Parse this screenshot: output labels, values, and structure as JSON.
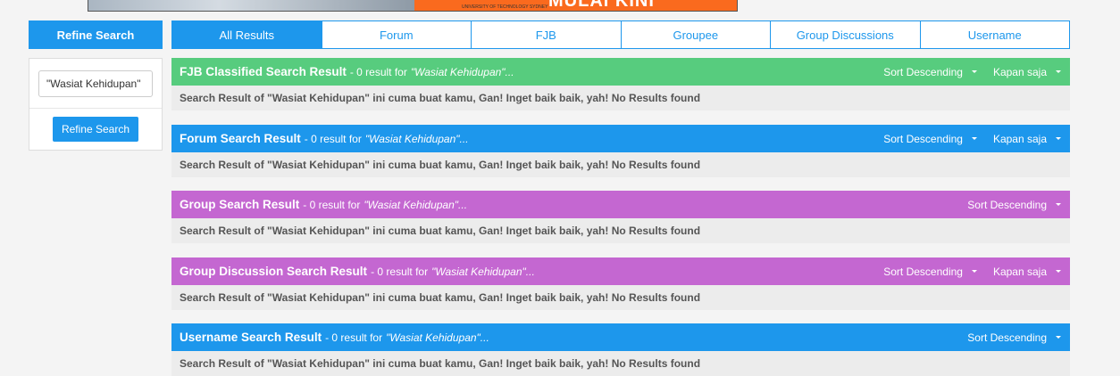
{
  "banner": {
    "university": "UNIVERSITY OF TECHNOLOGY SYDNEY",
    "cta": "MULAI KINI"
  },
  "sidebar": {
    "header": "Refine Search",
    "input_value": "\"Wasiat Kehidupan\"",
    "button_label": "Refine Search"
  },
  "tabs": [
    {
      "label": "All Results"
    },
    {
      "label": "Forum"
    },
    {
      "label": "FJB"
    },
    {
      "label": "Groupee"
    },
    {
      "label": "Group Discussions"
    },
    {
      "label": "Username"
    }
  ],
  "results": [
    {
      "title": "FJB Classified Search Result",
      "count": "- 0 result for",
      "query": "\"Wasiat Kehidupan\"...",
      "sort": "Sort Descending",
      "time": "Kapan saja",
      "message": "Search Result of \"Wasiat Kehidupan\" ini cuma buat kamu, Gan! Inget baik baik, yah! No Results found",
      "color": "#57cc7e"
    },
    {
      "title": "Forum Search Result",
      "count": "- 0 result for",
      "query": "\"Wasiat Kehidupan\"...",
      "sort": "Sort Descending",
      "time": "Kapan saja",
      "message": "Search Result of \"Wasiat Kehidupan\" ini cuma buat kamu, Gan! Inget baik baik, yah! No Results found",
      "color": "#1d97ec"
    },
    {
      "title": "Group Search Result",
      "count": "- 0 result for",
      "query": "\"Wasiat Kehidupan\"...",
      "sort": "Sort Descending",
      "message": "Search Result of \"Wasiat Kehidupan\" ini cuma buat kamu, Gan! Inget baik baik, yah! No Results found",
      "color": "#c467d1"
    },
    {
      "title": "Group Discussion Search Result",
      "count": "- 0 result for",
      "query": "\"Wasiat Kehidupan\"...",
      "sort": "Sort Descending",
      "time": "Kapan saja",
      "message": "Search Result of \"Wasiat Kehidupan\" ini cuma buat kamu, Gan! Inget baik baik, yah! No Results found",
      "color": "#c467d1"
    },
    {
      "title": "Username Search Result",
      "count": "- 0 result for",
      "query": "\"Wasiat Kehidupan\"...",
      "sort": "Sort Descending",
      "message": "Search Result of \"Wasiat Kehidupan\" ini cuma buat kamu, Gan! Inget baik baik, yah! No Results found",
      "color": "#1d97ec"
    }
  ]
}
